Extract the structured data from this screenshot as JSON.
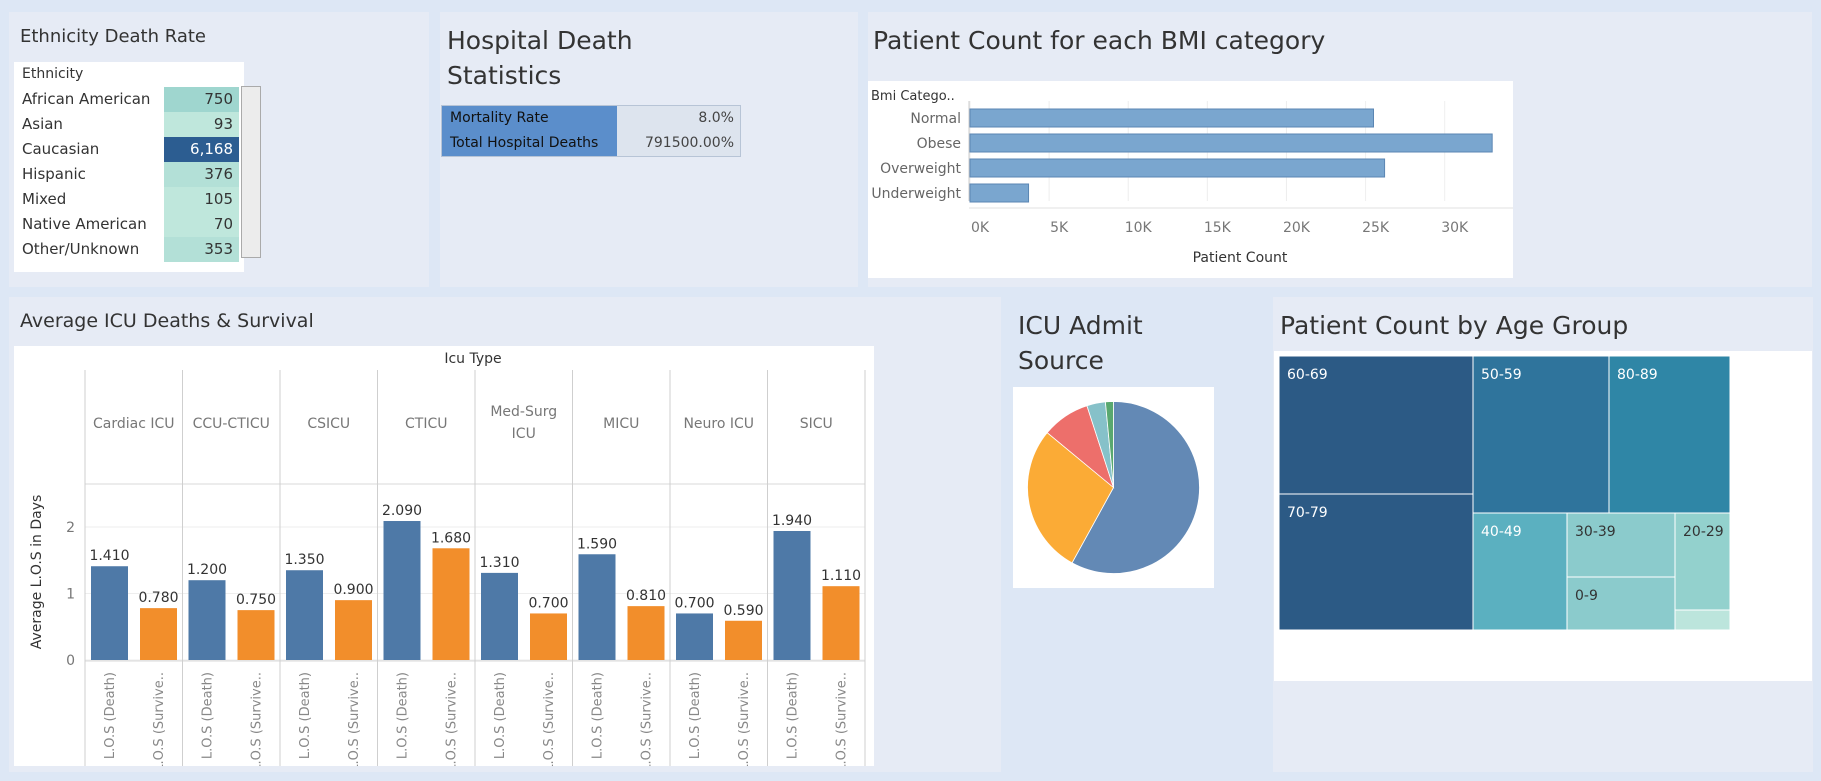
{
  "colors": {
    "bg": "#dde7f5",
    "panel": "#e6ebf5",
    "death_bar": "#4e79a7",
    "survive_bar": "#f28e2b",
    "bmi_bar": "#7aa6cf"
  },
  "ethnicity": {
    "title": "Ethnicity Death Rate",
    "header": "Ethnicity",
    "rows": [
      {
        "label": "African American",
        "value": "750",
        "shade": "#9fd6cf"
      },
      {
        "label": "Asian",
        "value": "93",
        "shade": "#bfe7dc"
      },
      {
        "label": "Caucasian",
        "value": "6,168",
        "shade": "#2c5d91"
      },
      {
        "label": "Hispanic",
        "value": "376",
        "shade": "#b3e0d7"
      },
      {
        "label": "Mixed",
        "value": "105",
        "shade": "#bfe7dc"
      },
      {
        "label": "Native American",
        "value": "70",
        "shade": "#bfe7dc"
      },
      {
        "label": "Other/Unknown",
        "value": "353",
        "shade": "#b3e0d7"
      }
    ]
  },
  "hospital": {
    "title_line1": "Hospital Death",
    "title_line2": "Statistics",
    "rows": [
      {
        "label": "Mortality Rate",
        "value": "8.0%"
      },
      {
        "label": "Total Hospital Deaths",
        "value": "791500.00%"
      }
    ]
  },
  "bmi": {
    "title": "Patient Count for each BMI category",
    "chart_data": {
      "type": "bar",
      "orientation": "horizontal",
      "axis_header": "Bmi Catego..",
      "categories": [
        "Normal",
        "Obese",
        "Overweight",
        "Underweight"
      ],
      "values": [
        25500,
        33000,
        26200,
        3700
      ],
      "xlabel": "Patient Count",
      "xticks": [
        "0K",
        "5K",
        "10K",
        "15K",
        "20K",
        "25K",
        "30K"
      ],
      "xlim": [
        0,
        34000
      ]
    }
  },
  "icu": {
    "title": "Average ICU Deaths & Survival",
    "chart_data": {
      "type": "bar",
      "column_header": "Icu Type",
      "categories": [
        "Cardiac ICU",
        "CCU-CTICU",
        "CSICU",
        "CTICU",
        "Med-Surg ICU",
        "MICU",
        "Neuro ICU",
        "SICU"
      ],
      "measure_labels": [
        "L.O.S (Death)",
        "L.O.S (Survive.."
      ],
      "series": [
        {
          "values": [
            1.41,
            1.2,
            1.35,
            2.09,
            1.31,
            1.59,
            0.7,
            1.94
          ],
          "labels": [
            "1.410",
            "1.200",
            "1.350",
            "2.090",
            "1.310",
            "1.590",
            "0.700",
            "1.940"
          ]
        },
        {
          "values": [
            0.78,
            0.75,
            0.9,
            1.68,
            0.7,
            0.81,
            0.59,
            1.11
          ],
          "labels": [
            "0.780",
            "0.750",
            "0.900",
            "1.680",
            "0.700",
            "0.810",
            "0.590",
            "1.110"
          ]
        }
      ],
      "ylabel": "Average L.O.S in Days",
      "yticks": [
        "0",
        "1",
        "2"
      ],
      "ylim": [
        0,
        2.5
      ]
    }
  },
  "admit": {
    "title_line1": "ICU Admit",
    "title_line2": "Source",
    "chart_data": {
      "type": "pie",
      "values": [
        58,
        28,
        9,
        3.5,
        1.5
      ],
      "colors": [
        "#6389b5",
        "#fbab36",
        "#ed6f6b",
        "#86c1c9",
        "#59a86f"
      ]
    }
  },
  "age": {
    "title": "Patient Count by Age Group",
    "chart_data": {
      "type": "heatmap",
      "subtype": "treemap",
      "labels": [
        "60-69",
        "70-79",
        "50-59",
        "80-89",
        "40-49",
        "30-39",
        "0-9",
        "20-29"
      ]
    }
  }
}
